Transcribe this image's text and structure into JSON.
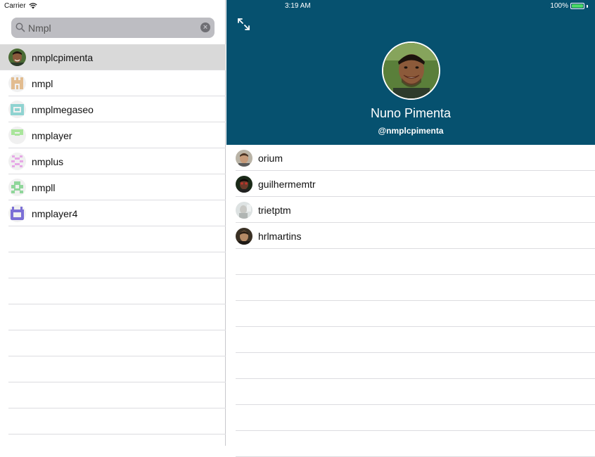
{
  "status_bar": {
    "carrier": "Carrier",
    "time": "3:19 AM",
    "battery_percent": "100%",
    "battery_level": 1.0
  },
  "search": {
    "value": "Nmpl",
    "placeholder": "Search"
  },
  "results": [
    {
      "username": "nmplcpimenta",
      "selected": true,
      "avatar": "photo"
    },
    {
      "username": "nmpl",
      "selected": false,
      "avatar": "identicon",
      "color": "#e2bc8f"
    },
    {
      "username": "nmplmegaseo",
      "selected": false,
      "avatar": "identicon",
      "color": "#8fd3d1"
    },
    {
      "username": "nmplayer",
      "selected": false,
      "avatar": "identicon",
      "color": "#a9e59b"
    },
    {
      "username": "nmplus",
      "selected": false,
      "avatar": "identicon",
      "color": "#e6a9e6"
    },
    {
      "username": "nmpll",
      "selected": false,
      "avatar": "identicon",
      "color": "#8fd69a"
    },
    {
      "username": "nmplayer4",
      "selected": false,
      "avatar": "identicon",
      "color": "#7b6fd6"
    }
  ],
  "profile": {
    "name": "Nuno Pimenta",
    "handle": "@nmplcpimenta",
    "header_color": "#06516f"
  },
  "followers": [
    {
      "username": "orium"
    },
    {
      "username": "guilhermemtr"
    },
    {
      "username": "trietptm"
    },
    {
      "username": "hrlmartins"
    }
  ],
  "icons": {
    "search": "search-icon",
    "clear": "clear-icon",
    "expand": "expand-icon",
    "wifi": "wifi-icon",
    "battery": "battery-icon"
  }
}
